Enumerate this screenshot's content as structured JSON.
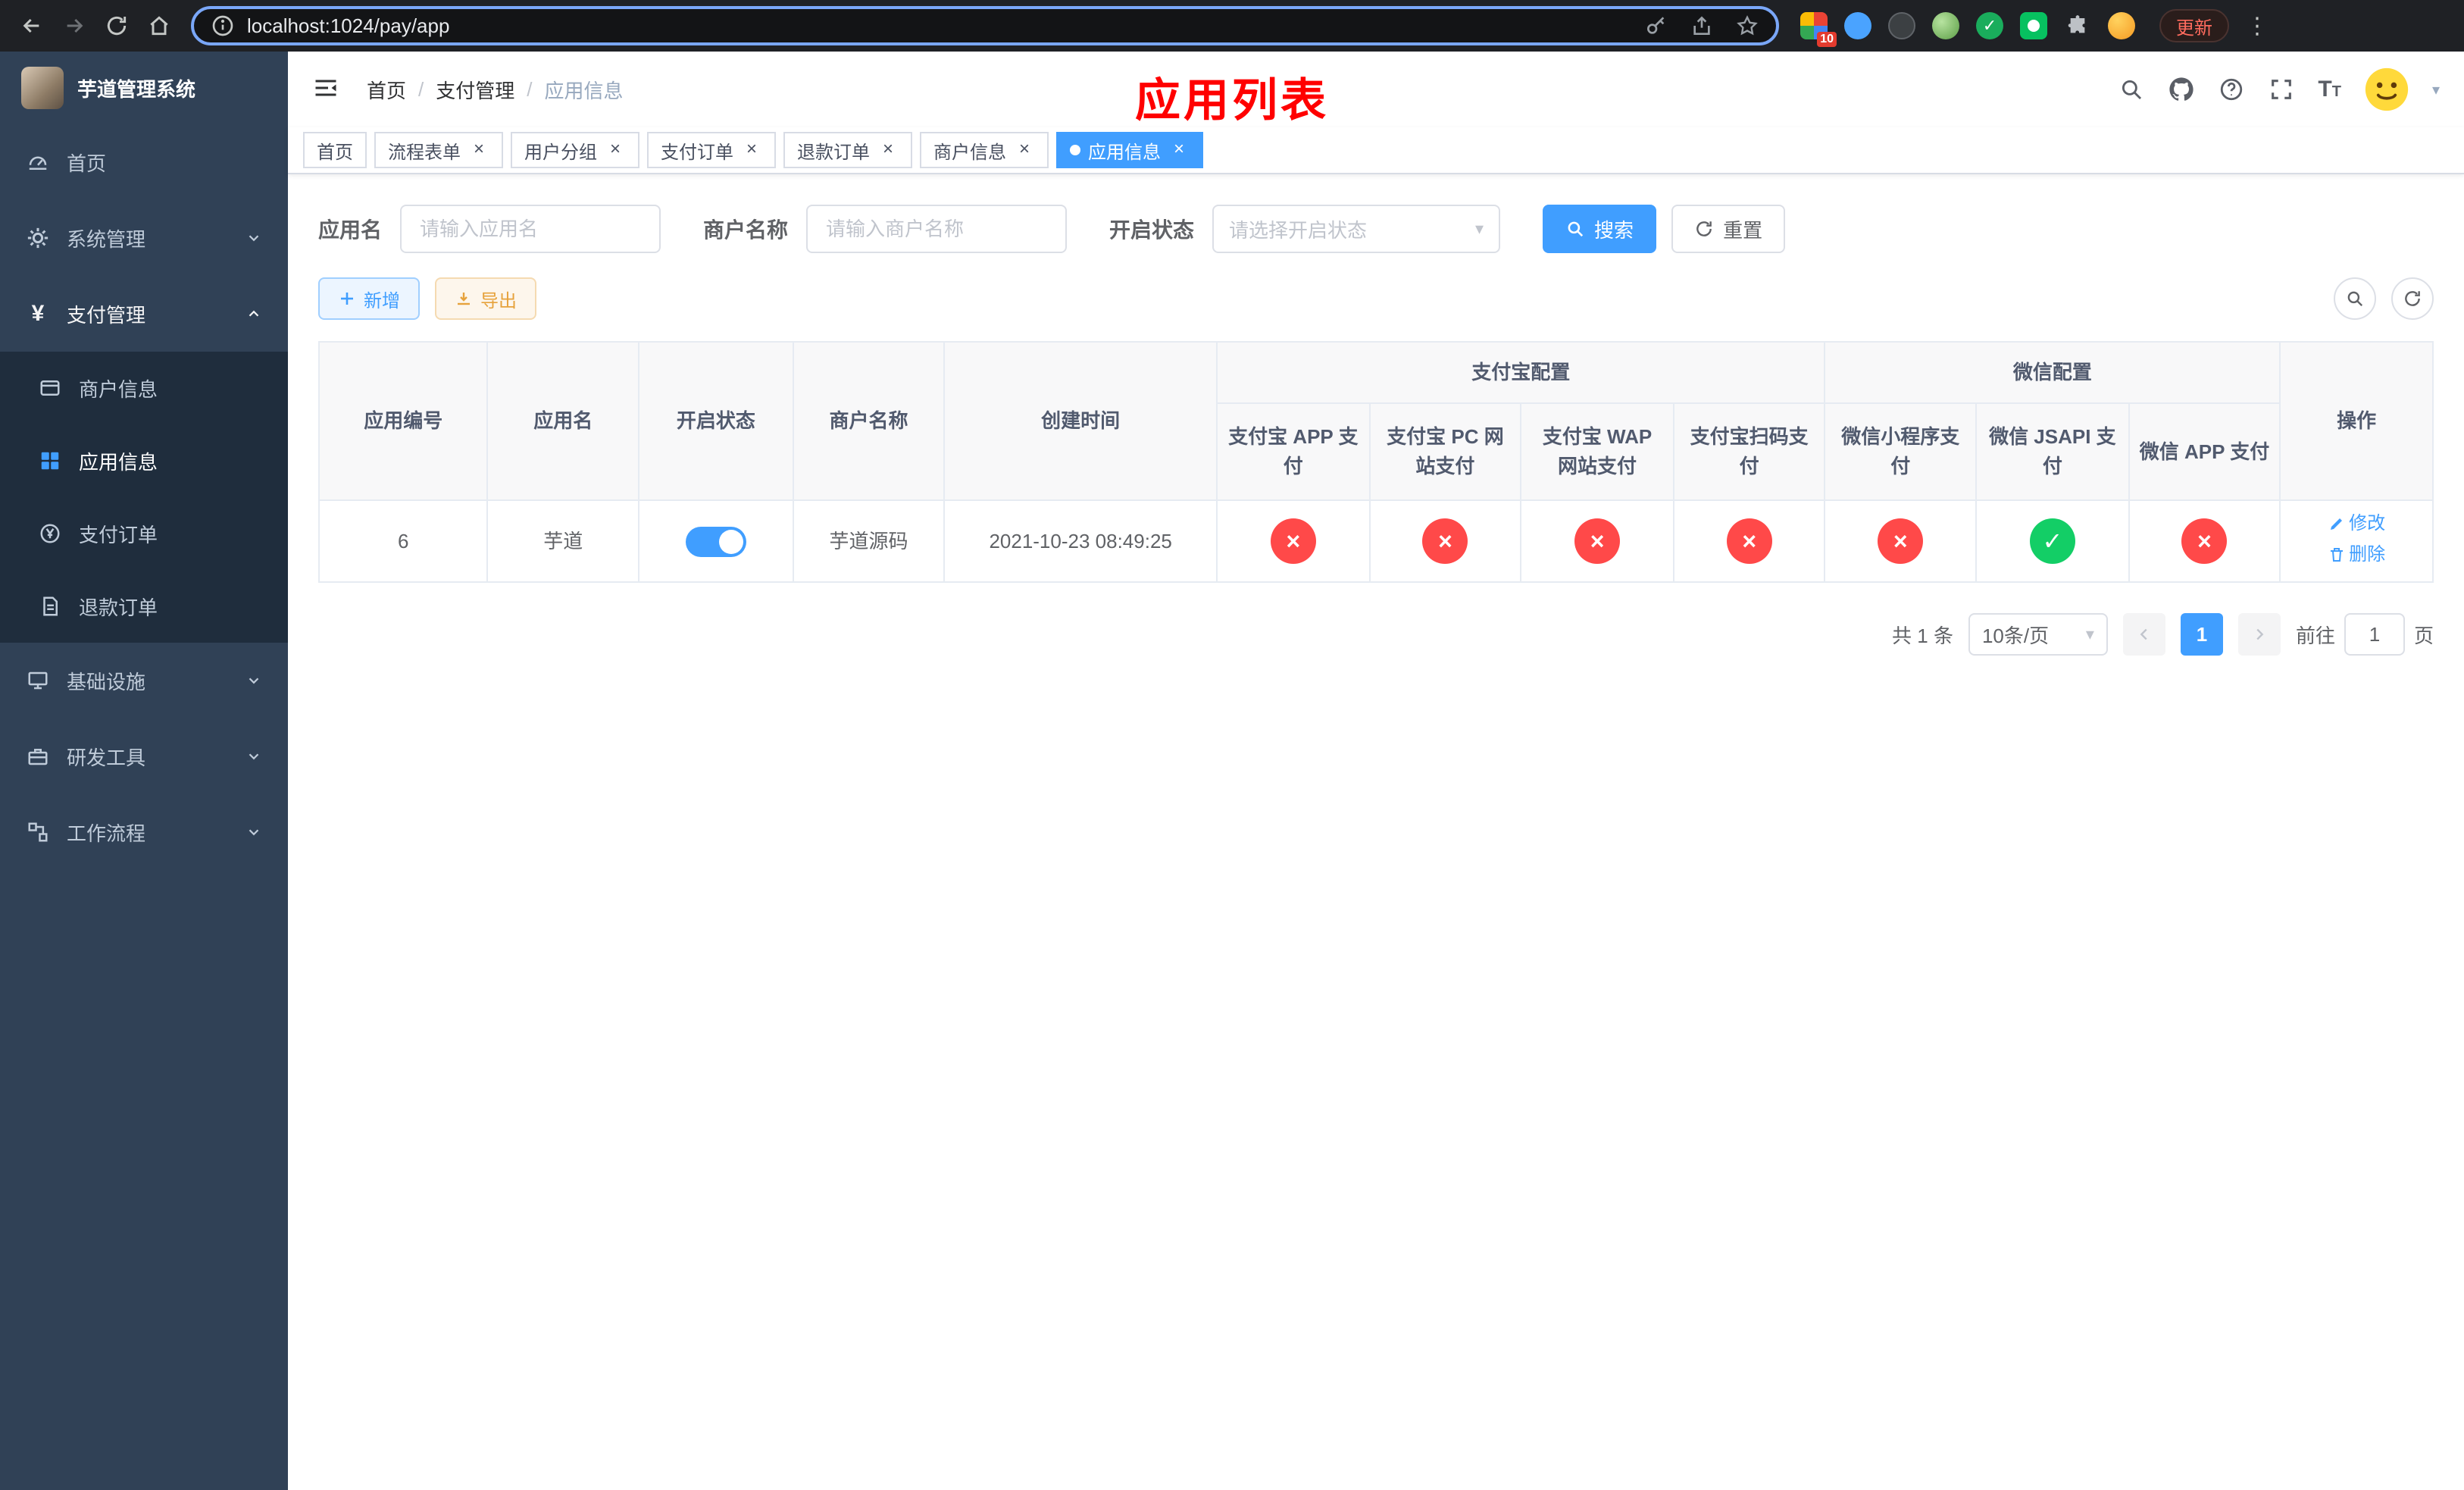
{
  "colors": {
    "accent": "#409eff",
    "danger": "#ff4949",
    "success": "#13ce66",
    "warning": "#e6a23c",
    "annotation": "#ff0000",
    "sidebar_bg": "#304156",
    "submenu_bg": "#1f2d3d"
  },
  "browser": {
    "url": "localhost:1024/pay/app",
    "extension_badge": "10",
    "update_label": "更新"
  },
  "sidebar": {
    "title": "芋道管理系统",
    "items": [
      {
        "label": "首页"
      },
      {
        "label": "系统管理"
      },
      {
        "label": "支付管理",
        "children": [
          {
            "label": "商户信息"
          },
          {
            "label": "应用信息"
          },
          {
            "label": "支付订单"
          },
          {
            "label": "退款订单"
          }
        ]
      },
      {
        "label": "基础设施"
      },
      {
        "label": "研发工具"
      },
      {
        "label": "工作流程"
      }
    ]
  },
  "header": {
    "breadcrumb": {
      "items": [
        "首页",
        "支付管理",
        "应用信息"
      ],
      "separator": "/"
    },
    "annotation": "应用列表"
  },
  "tabs": [
    {
      "label": "首页"
    },
    {
      "label": "流程表单"
    },
    {
      "label": "用户分组"
    },
    {
      "label": "支付订单"
    },
    {
      "label": "退款订单"
    },
    {
      "label": "商户信息"
    },
    {
      "label": "应用信息"
    }
  ],
  "tab_close": "×",
  "filters": {
    "app_name": {
      "label": "应用名",
      "placeholder": "请输入应用名",
      "value": ""
    },
    "merchant_name": {
      "label": "商户名称",
      "placeholder": "请输入商户名称",
      "value": ""
    },
    "status": {
      "label": "开启状态",
      "placeholder": "请选择开启状态",
      "value": ""
    },
    "search_label": "搜索",
    "reset_label": "重置"
  },
  "toolbar": {
    "add_label": "新增",
    "export_label": "导出"
  },
  "table": {
    "columns": {
      "app_id": "应用编号",
      "app_name": "应用名",
      "status": "开启状态",
      "merchant": "商户名称",
      "created": "创建时间",
      "actions": "操作",
      "alipay_group": "支付宝配置",
      "wechat_group": "微信配置",
      "alipay_app": "支付宝 APP 支付",
      "alipay_pc": "支付宝 PC 网站支付",
      "alipay_wap": "支付宝 WAP 网站支付",
      "alipay_scan": "支付宝扫码支付",
      "wechat_mini": "微信小程序支付",
      "wechat_jsapi": "微信 JSAPI 支付",
      "wechat_app": "微信 APP 支付"
    },
    "row": {
      "app_id": "6",
      "app_name": "芋道",
      "enabled": true,
      "merchant": "芋道源码",
      "created": "2021-10-23 08:49:25",
      "statuses": [
        false,
        false,
        false,
        false,
        false,
        true,
        false
      ],
      "edit_label": "修改",
      "delete_label": "删除"
    }
  },
  "pagination": {
    "total": "共 1 条",
    "page_size": "10条/页",
    "current_page": "1",
    "goto_label": "前往",
    "goto_value": "1",
    "goto_suffix": "页"
  }
}
